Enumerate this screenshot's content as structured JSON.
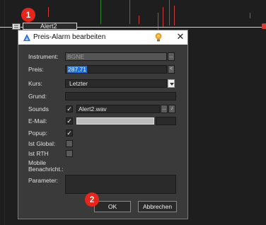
{
  "chart": {
    "alert_tag": "Alert2"
  },
  "badges": {
    "first": "1",
    "second": "2"
  },
  "dialog": {
    "title": "Preis-Alarm bearbeiten",
    "close_label": "✕",
    "labels": {
      "instrument": "Instrument:",
      "price": "Preis:",
      "course": "Kurs:",
      "reason": "Grund:",
      "sounds": "Sounds",
      "email": "E-Mail:",
      "popup": "Popup:",
      "is_global": "Ist Global:",
      "is_rth": "Ist RTH",
      "mobile_notify_line1": "Mobile",
      "mobile_notify_line2": "Benachricht.:",
      "parameter": "Parameter:"
    },
    "values": {
      "instrument": "BGNE",
      "price": "287,71",
      "course": "Letzter",
      "reason": "",
      "sound_file": "Alert2.wav",
      "parameter": ""
    },
    "buttons": {
      "instrument_more": "...",
      "price_step": "<",
      "sound_more": "...",
      "ok": "OK",
      "cancel": "Abbrechen"
    },
    "checkboxes": {
      "sounds": true,
      "email": true,
      "popup": true,
      "is_global": false,
      "is_rth": false
    }
  },
  "colors": {
    "badge": "#e8251a",
    "selection": "#1f6fd6",
    "dialog_bg": "#3a3a3a"
  }
}
